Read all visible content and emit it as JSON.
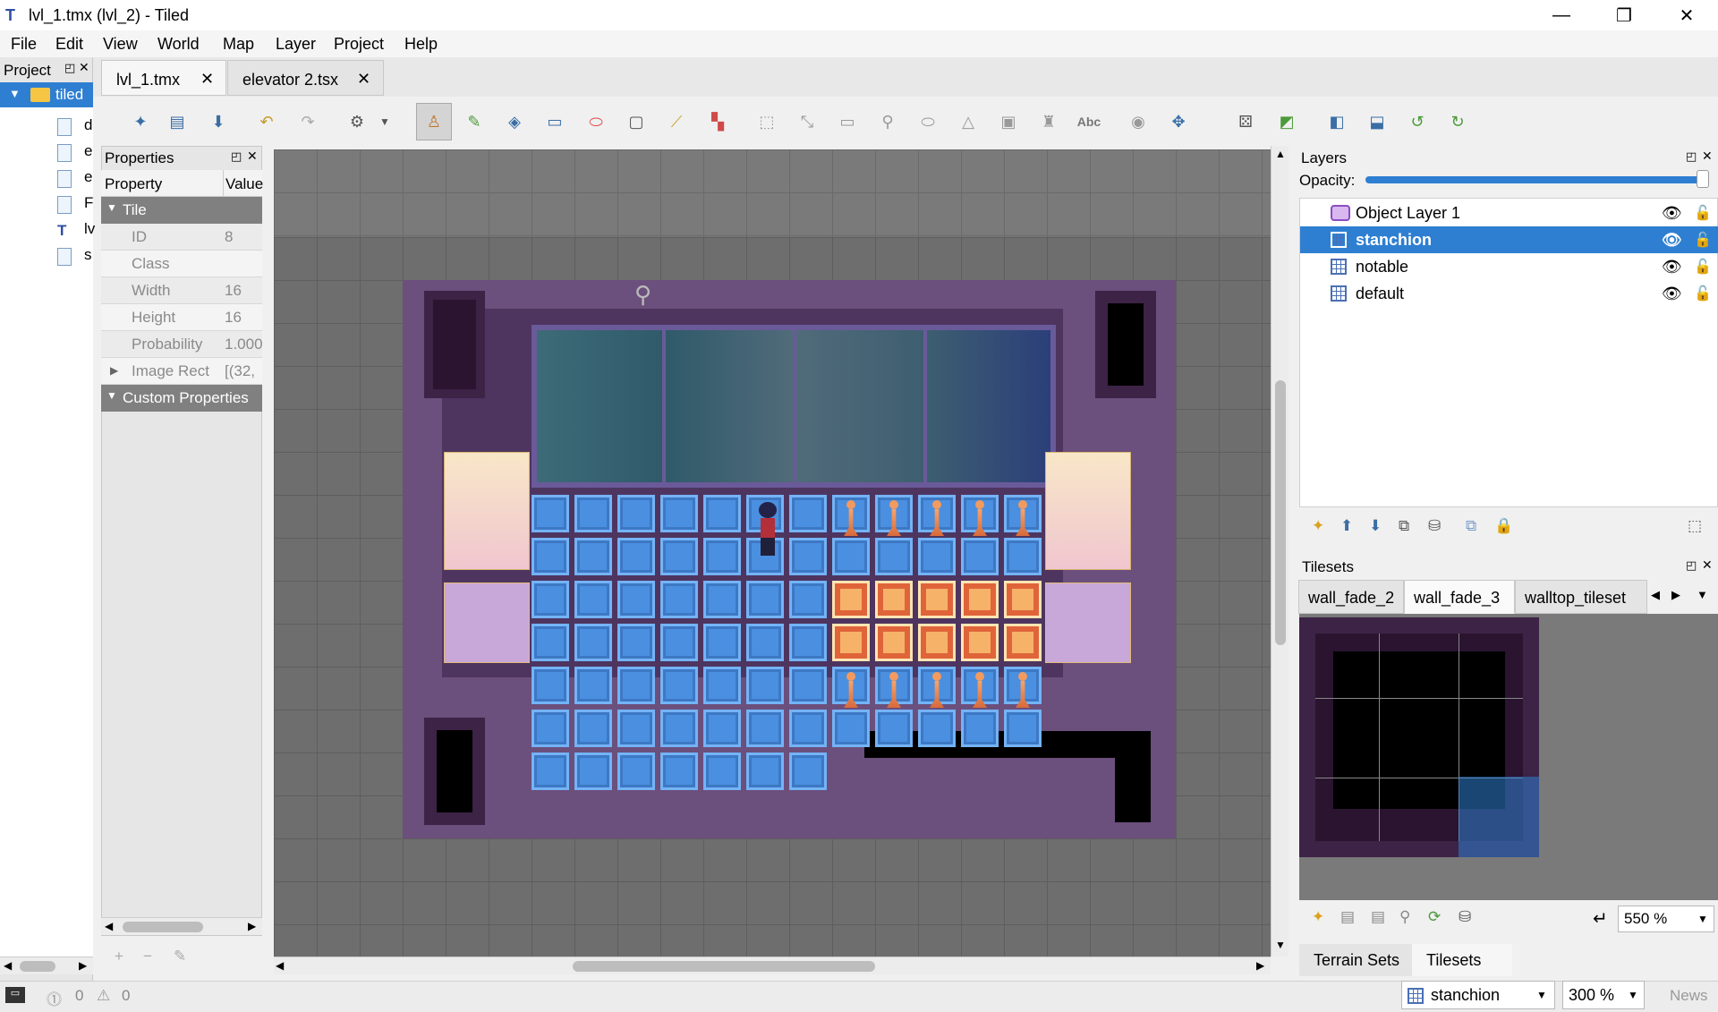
{
  "window": {
    "title": "lvl_1.tmx (lvl_2) - Tiled"
  },
  "menu": [
    "File",
    "Edit",
    "View",
    "World",
    "Map",
    "Layer",
    "Project",
    "Help"
  ],
  "project_panel": {
    "title": "Project",
    "root": "tiled",
    "items": [
      "d",
      "e",
      "e",
      "F",
      "lv",
      "s"
    ]
  },
  "tabs": [
    {
      "label": "lvl_1.tmx"
    },
    {
      "label": "elevator 2.tsx"
    }
  ],
  "properties": {
    "title": "Properties",
    "col_property": "Property",
    "col_value": "Value",
    "group_tile": "Tile",
    "rows": [
      {
        "key": "ID",
        "value": "8"
      },
      {
        "key": "Class",
        "value": ""
      },
      {
        "key": "Width",
        "value": "16"
      },
      {
        "key": "Height",
        "value": "16"
      },
      {
        "key": "Probability",
        "value": "1.000"
      },
      {
        "key": "Image Rect",
        "value": "[(32,"
      }
    ],
    "group_custom": "Custom Properties"
  },
  "layers_panel": {
    "title": "Layers",
    "opacity_label": "Opacity:",
    "opacity_value": 1.0,
    "layers": [
      {
        "name": "Object Layer 1",
        "type": "object",
        "selected": false
      },
      {
        "name": "stanchion",
        "type": "tile",
        "selected": true
      },
      {
        "name": "notable",
        "type": "tile",
        "selected": false
      },
      {
        "name": "default",
        "type": "tile",
        "selected": false
      }
    ]
  },
  "tilesets_panel": {
    "title": "Tilesets",
    "tabs": [
      "wall_fade_2",
      "wall_fade_3",
      "walltop_tileset"
    ],
    "active_tab": "wall_fade_3",
    "zoom": "550 %"
  },
  "bottom_tabs": [
    "Terrain Sets",
    "Tilesets"
  ],
  "status": {
    "errors": "0",
    "warnings": "0",
    "layer_combo": "stanchion",
    "zoom_combo": "300 %",
    "news": "News"
  },
  "colors": {
    "accent": "#2e7fd1",
    "floor": "#4a8fe0",
    "wall": "#6b4f7c",
    "dark": "#2a1430"
  }
}
